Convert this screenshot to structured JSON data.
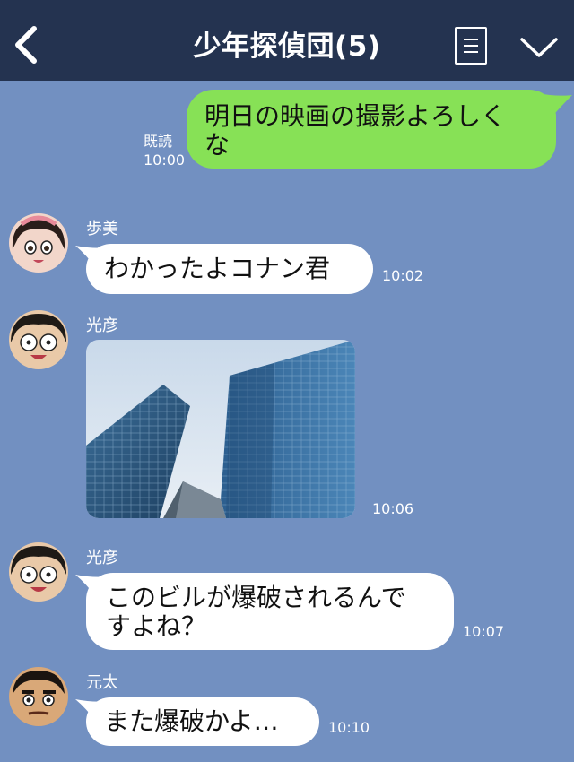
{
  "header": {
    "title": "少年探偵団(5)",
    "back_icon": "chevron-left-icon",
    "menu_icon": "menu-list-icon",
    "dropdown_icon": "chevron-down-icon"
  },
  "colors": {
    "header_bg": "#243350",
    "chat_bg": "#7290c1",
    "my_bubble": "#87e156",
    "their_bubble": "#ffffff"
  },
  "messages": [
    {
      "sender": "me",
      "text_line1": "明日の映画の撮影よろしく",
      "text_line2": "な",
      "read_label": "既読",
      "time": "10:00"
    },
    {
      "sender": "歩美",
      "text": "わかったよコナン君",
      "time": "10:02"
    },
    {
      "sender": "光彦",
      "type": "image",
      "image": "office-buildings-photo",
      "time": "10:06"
    },
    {
      "sender": "光彦",
      "text_line1": "このビルが爆破されるんで",
      "text_line2": "すよね？",
      "time": "10:07"
    },
    {
      "sender": "元太",
      "text": "また爆破かよ…",
      "time": "10:10"
    }
  ]
}
